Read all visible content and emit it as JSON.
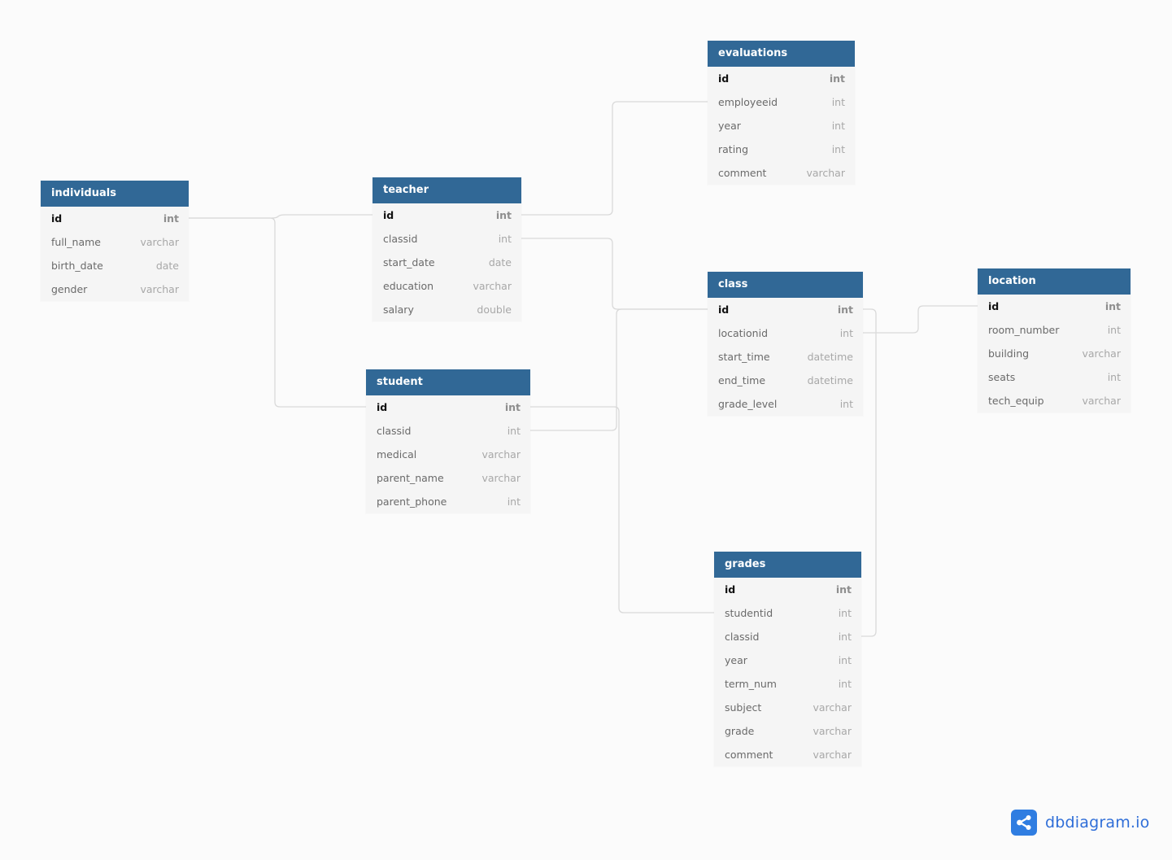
{
  "diagram": {
    "tables": [
      {
        "key": "individuals",
        "name": "individuals",
        "fields": [
          {
            "name": "id",
            "type": "int",
            "pk": true
          },
          {
            "name": "full_name",
            "type": "varchar",
            "pk": false
          },
          {
            "name": "birth_date",
            "type": "date",
            "pk": false
          },
          {
            "name": "gender",
            "type": "varchar",
            "pk": false
          }
        ]
      },
      {
        "key": "teacher",
        "name": "teacher",
        "fields": [
          {
            "name": "id",
            "type": "int",
            "pk": true
          },
          {
            "name": "classid",
            "type": "int",
            "pk": false
          },
          {
            "name": "start_date",
            "type": "date",
            "pk": false
          },
          {
            "name": "education",
            "type": "varchar",
            "pk": false
          },
          {
            "name": "salary",
            "type": "double",
            "pk": false
          }
        ]
      },
      {
        "key": "student",
        "name": "student",
        "fields": [
          {
            "name": "id",
            "type": "int",
            "pk": true
          },
          {
            "name": "classid",
            "type": "int",
            "pk": false
          },
          {
            "name": "medical",
            "type": "varchar",
            "pk": false
          },
          {
            "name": "parent_name",
            "type": "varchar",
            "pk": false
          },
          {
            "name": "parent_phone",
            "type": "int",
            "pk": false
          }
        ]
      },
      {
        "key": "evaluations",
        "name": "evaluations",
        "fields": [
          {
            "name": "id",
            "type": "int",
            "pk": true
          },
          {
            "name": "employeeid",
            "type": "int",
            "pk": false
          },
          {
            "name": "year",
            "type": "int",
            "pk": false
          },
          {
            "name": "rating",
            "type": "int",
            "pk": false
          },
          {
            "name": "comment",
            "type": "varchar",
            "pk": false
          }
        ]
      },
      {
        "key": "class",
        "name": "class",
        "fields": [
          {
            "name": "id",
            "type": "int",
            "pk": true
          },
          {
            "name": "locationid",
            "type": "int",
            "pk": false
          },
          {
            "name": "start_time",
            "type": "datetime",
            "pk": false
          },
          {
            "name": "end_time",
            "type": "datetime",
            "pk": false
          },
          {
            "name": "grade_level",
            "type": "int",
            "pk": false
          }
        ]
      },
      {
        "key": "location",
        "name": "location",
        "fields": [
          {
            "name": "id",
            "type": "int",
            "pk": true
          },
          {
            "name": "room_number",
            "type": "int",
            "pk": false
          },
          {
            "name": "building",
            "type": "varchar",
            "pk": false
          },
          {
            "name": "seats",
            "type": "int",
            "pk": false
          },
          {
            "name": "tech_equip",
            "type": "varchar",
            "pk": false
          }
        ]
      },
      {
        "key": "grades",
        "name": "grades",
        "fields": [
          {
            "name": "id",
            "type": "int",
            "pk": true
          },
          {
            "name": "studentid",
            "type": "int",
            "pk": false
          },
          {
            "name": "classid",
            "type": "int",
            "pk": false
          },
          {
            "name": "year",
            "type": "int",
            "pk": false
          },
          {
            "name": "term_num",
            "type": "int",
            "pk": false
          },
          {
            "name": "subject",
            "type": "varchar",
            "pk": false
          },
          {
            "name": "grade",
            "type": "varchar",
            "pk": false
          },
          {
            "name": "comment",
            "type": "varchar",
            "pk": false
          }
        ]
      }
    ],
    "relationships": [
      {
        "from": "individuals.id",
        "to": "teacher.id"
      },
      {
        "from": "individuals.id",
        "to": "student.id"
      },
      {
        "from": "teacher.id",
        "to": "evaluations.employeeid"
      },
      {
        "from": "teacher.classid",
        "to": "class.id"
      },
      {
        "from": "student.classid",
        "to": "class.id"
      },
      {
        "from": "student.id",
        "to": "grades.studentid"
      },
      {
        "from": "class.id",
        "to": "grades.classid"
      },
      {
        "from": "class.locationid",
        "to": "location.id"
      }
    ]
  },
  "brand": {
    "name": "dbdiagram.io",
    "icon": "share-nodes-icon",
    "color": "#2f7de1"
  },
  "colors": {
    "header": "#316896",
    "table_body": "#f5f5f5",
    "background": "#fbfbfb",
    "connector": "#d9d9d9"
  }
}
